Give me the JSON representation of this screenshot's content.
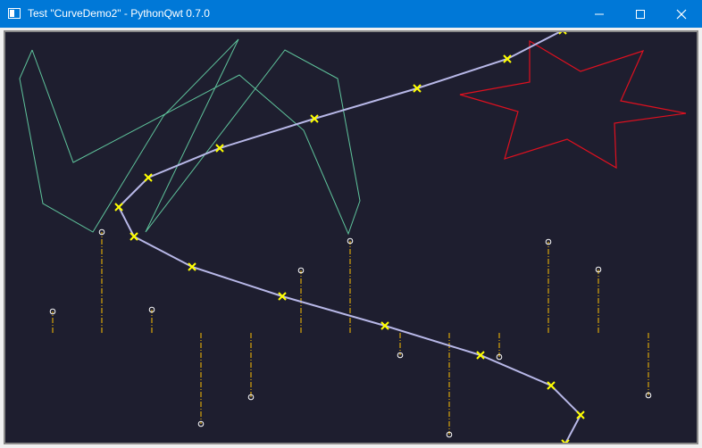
{
  "window": {
    "title": "Test \"CurveDemo2\" - PythonQwt 0.7.0",
    "controls": {
      "minimize": "minimize-icon",
      "maximize": "maximize-icon",
      "close": "close-icon"
    }
  },
  "colors": {
    "titlebar": "#0078d7",
    "canvas_background": "#1e1e2f",
    "main_curve": "#b8b8e8",
    "main_markers": "#ffff00",
    "zigzag_curve": "#5fc49c",
    "star_curve": "#e0101f",
    "sticks": "#ffc000",
    "stick_markers": "#ffffff"
  },
  "chart_data": {
    "type": "line",
    "title": "",
    "xlabel": "",
    "ylabel": "",
    "grid": false,
    "legend": "none"
  }
}
